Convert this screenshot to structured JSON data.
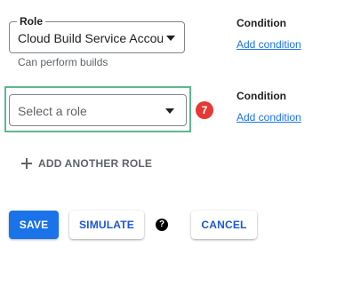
{
  "role_binding": {
    "label": "Role",
    "selected_role": "Cloud Build Service Account",
    "helper_text": "Can perform builds",
    "condition_heading": "Condition",
    "condition_link": "Add condition"
  },
  "new_role_binding": {
    "placeholder": "Select a role",
    "step_badge": "7",
    "condition_heading": "Condition",
    "condition_link": "Add condition"
  },
  "add_another_role_label": "ADD ANOTHER ROLE",
  "actions": {
    "save_label": "SAVE",
    "simulate_label": "SIMULATE",
    "help_glyph": "?",
    "cancel_label": "CANCEL"
  },
  "colors": {
    "primary": "#1a73e8",
    "highlight": "#5cb88e",
    "badge": "#e53935"
  },
  "icons": [
    "dropdown-arrow-icon",
    "plus-icon",
    "help-icon"
  ]
}
